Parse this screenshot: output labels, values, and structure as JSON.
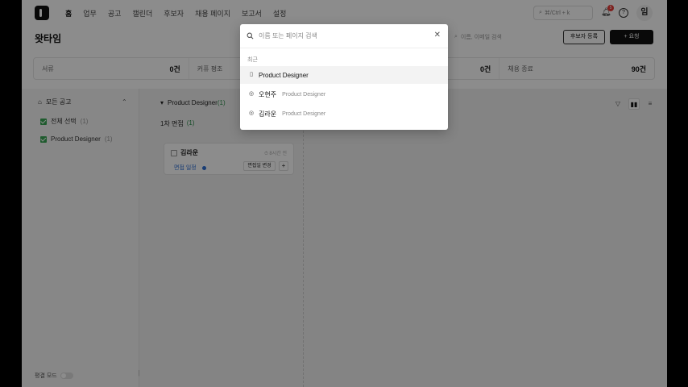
{
  "nav": {
    "items": [
      "홈",
      "업무",
      "공고",
      "캘린더",
      "후보자",
      "채용 페이지",
      "보고서",
      "설정"
    ],
    "shortcut": "⌘/Ctrl + k",
    "notification_count": "5",
    "avatar_initial": "임"
  },
  "header": {
    "title": "왓타임",
    "search_placeholder": "이름, 이메일 검색",
    "register_button": "후보자 등록",
    "request_button": "+ 요청"
  },
  "stats": [
    {
      "label": "서류",
      "value": "0건"
    },
    {
      "label": "커퓨 평조",
      "value": ""
    },
    {
      "label": "",
      "value": "0건"
    },
    {
      "label": "채용 종료",
      "value": "90건"
    }
  ],
  "sidebar": {
    "heading": "모든 공고",
    "items": [
      {
        "label": "전체 선택",
        "count": "(1)"
      },
      {
        "label": "Product Designer",
        "count": "(1)"
      }
    ],
    "footer_label": "평결 모드"
  },
  "board": {
    "column_title": "Product Designer",
    "column_count": "(1)",
    "stage_title": "1차 면접",
    "stage_count": "(1)",
    "card": {
      "name": "김라운",
      "meta": "⏱ 8시간 전",
      "status": "면접 일정",
      "action_button": "면접일 변경"
    }
  },
  "palette": {
    "placeholder": "이름 또는 페이지 검색",
    "section_label": "최근",
    "results": [
      {
        "title": "Product Designer",
        "subtitle": "",
        "type": "page"
      },
      {
        "title": "오현주",
        "subtitle": "Product Designer",
        "type": "person"
      },
      {
        "title": "김라운",
        "subtitle": "Product Designer",
        "type": "person"
      }
    ]
  }
}
